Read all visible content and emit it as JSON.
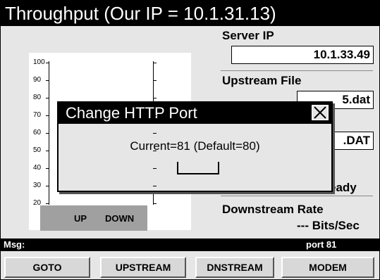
{
  "window": {
    "title": "Throughput (Our IP = 10.1.31.13)"
  },
  "server_ip": {
    "label": "Server IP",
    "value": "10.1.33.49"
  },
  "upstream_file": {
    "label": "Upstream File",
    "value_visible": "5.dat"
  },
  "downstream_file": {
    "label_visible": "e",
    "value_visible": ".DAT"
  },
  "status_visible": "eady",
  "downstream_rate": {
    "label": "Downstream Rate",
    "value": "--- Bits/Sec"
  },
  "gauge": {
    "ticks": [
      "100",
      "90",
      "80",
      "70",
      "60",
      "50",
      "40",
      "30",
      "20"
    ],
    "labels": [
      "UP",
      "DOWN"
    ]
  },
  "dialog": {
    "title": "Change HTTP Port",
    "current_text": "Current=81 (Default=80)",
    "port_value": ""
  },
  "message_bar": {
    "label": "Msg:",
    "status": "port 81"
  },
  "buttons": [
    "GOTO",
    "UPSTREAM",
    "DNSTREAM",
    "MODEM"
  ]
}
